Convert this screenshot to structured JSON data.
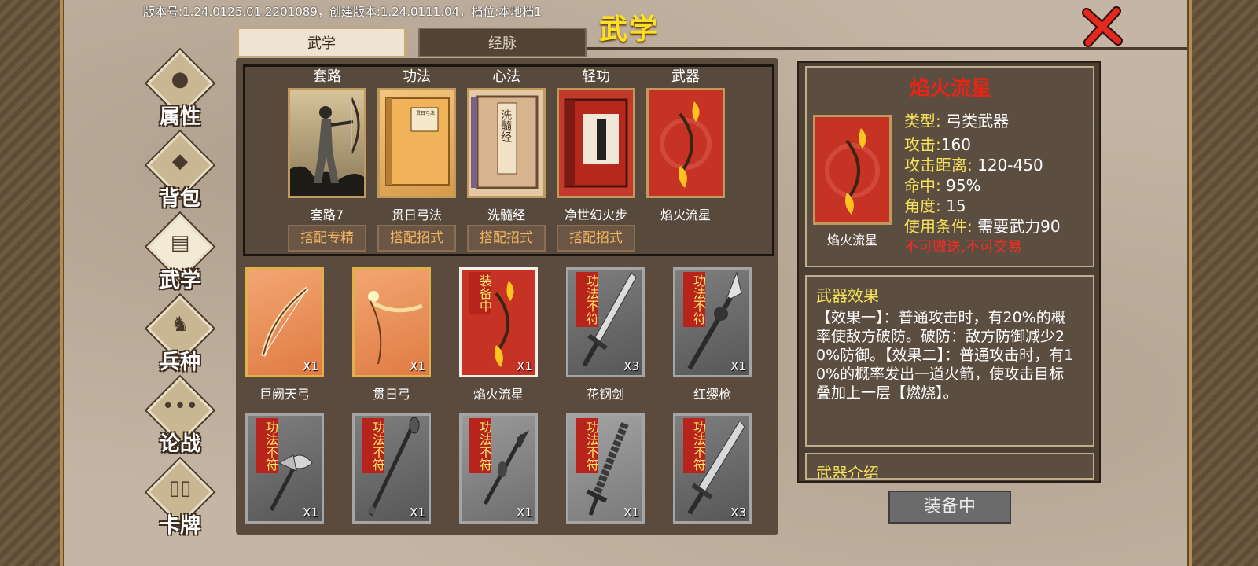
{
  "header": {
    "version_text": "版本号:1.24.0125.01.2201089，创建版本:1.24.0111.04，档位:本地档1",
    "title": "武学"
  },
  "tabs": [
    {
      "label": "武学",
      "active": true
    },
    {
      "label": "经脉",
      "active": false
    }
  ],
  "sidebar": {
    "items": [
      {
        "label": "属性",
        "icon": "person-icon"
      },
      {
        "label": "背包",
        "icon": "bag-icon"
      },
      {
        "label": "武学",
        "icon": "book-icon",
        "active": true
      },
      {
        "label": "兵种",
        "icon": "cavalry-icon"
      },
      {
        "label": "论战",
        "icon": "chat-icon"
      },
      {
        "label": "卡牌",
        "icon": "cards-icon"
      }
    ]
  },
  "equipped": {
    "slots": [
      {
        "header": "套路",
        "name": "套路7",
        "button": "搭配专精"
      },
      {
        "header": "功法",
        "name": "贯日弓法",
        "button": "搭配招式"
      },
      {
        "header": "心法",
        "name": "洗髓经",
        "button": "搭配招式"
      },
      {
        "header": "轻功",
        "name": "净世幻火步",
        "button": "搭配招式"
      },
      {
        "header": "武器",
        "name": "焰火流星"
      }
    ],
    "book_text_xinfa": "洗髓经",
    "book_text_gongfa": "贯日弓法"
  },
  "inventory": {
    "items": [
      {
        "name": "巨阙天弓",
        "count": "X1",
        "style": "orange"
      },
      {
        "name": "贯日弓",
        "count": "X1",
        "style": "orange"
      },
      {
        "name": "焰火流星",
        "count": "X1",
        "style": "red",
        "tag": "装备中"
      },
      {
        "name": "花钢剑",
        "count": "X3",
        "style": "grey",
        "tag": "功法不符"
      },
      {
        "name": "红缨枪",
        "count": "X1",
        "style": "grey",
        "tag": "功法不符"
      },
      {
        "name": "",
        "count": "X1",
        "style": "grey",
        "tag": "功法不符"
      },
      {
        "name": "",
        "count": "X1",
        "style": "grey",
        "tag": "功法不符"
      },
      {
        "name": "",
        "count": "X1",
        "style": "grey",
        "tag": "功法不符"
      },
      {
        "name": "",
        "count": "X1",
        "style": "grey",
        "tag": "功法不符"
      },
      {
        "name": "",
        "count": "X3",
        "style": "grey",
        "tag": "功法不符"
      }
    ]
  },
  "detail": {
    "title": "焰火流星",
    "card_name": "焰火流星",
    "stats": [
      {
        "key": "类型",
        "value": " 弓类武器"
      },
      {
        "key": "攻击",
        "value": "160"
      },
      {
        "key": "攻击距离",
        "value": " 120-450"
      },
      {
        "key": "命中",
        "value": " 95%"
      },
      {
        "key": "角度",
        "value": " 15"
      },
      {
        "key": "使用条件",
        "value": " 需要武力90"
      }
    ],
    "restriction": "不可赠送,不可交易",
    "effect_title": "武器效果",
    "effect_text": "【效果一】：普通攻击时，有20%的概率使敌方破防。破防：敌方防御减少20%防御。【效果二】：普通攻击时，有10%的概率发出一道火箭，使攻击目标叠加上一层【燃烧】。",
    "intro_title": "武器介绍",
    "equip_button": "装备中"
  },
  "colors": {
    "title_yellow": "#ffe020",
    "detail_title_red": "#e62418",
    "stat_key_yellow": "#f5e15a",
    "tag_red": "#b6241b",
    "button_orange_text": "#f0b45f"
  }
}
